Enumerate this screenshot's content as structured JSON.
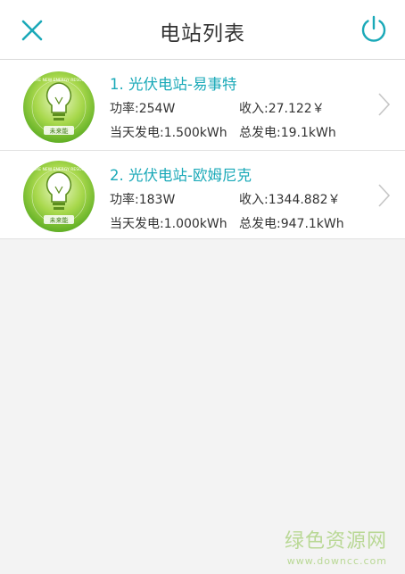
{
  "header": {
    "title": "电站列表",
    "close_icon": "close-icon",
    "power_icon": "power-icon",
    "accent": "#1aa9b8"
  },
  "stations": [
    {
      "name": "1. 光伏电站-易事特",
      "power": "功率:254W",
      "income": "收入:27.122￥",
      "today": "当天发电:1.500kWh",
      "total": "总发电:19.1kWh"
    },
    {
      "name": "2. 光伏电站-欧姆尼克",
      "power": "功率:183W",
      "income": "收入:1344.882￥",
      "today": "当天发电:1.000kWh",
      "total": "总发电:947.1kWh"
    }
  ],
  "logo": {
    "ring_text": "FUTURE NEW ENERGY RESOURCE",
    "brand": "未来能",
    "green": "#7fc23a"
  },
  "watermark": {
    "title": "绿色资源网",
    "url": "www.downcc.com"
  }
}
